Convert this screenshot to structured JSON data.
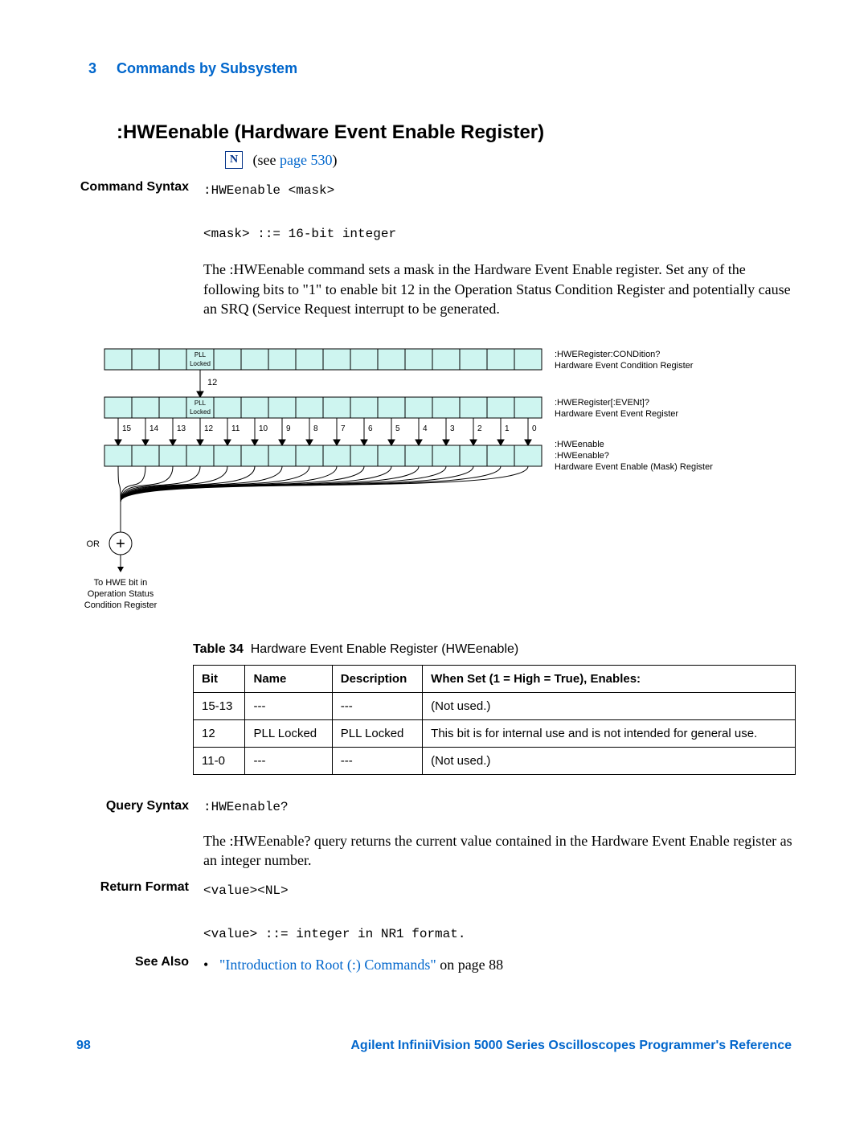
{
  "header": {
    "chapter_num": "3",
    "chapter_title": "Commands by Subsystem"
  },
  "title": ":HWEenable (Hardware Event Enable Register)",
  "see_prefix": "(see ",
  "see_link": "page 530",
  "see_suffix": ")",
  "command_syntax": {
    "label": "Command Syntax",
    "line1": ":HWEenable <mask>",
    "line2": "<mask> ::= 16-bit integer"
  },
  "desc_para": "The :HWEenable command sets a mask in the Hardware Event Enable register. Set any of the following bits to \"1\" to enable bit 12 in the Operation Status Condition Register and potentially cause an SRQ (Service Request interrupt to be generated.",
  "diagram": {
    "pll_label_top": "PLL",
    "pll_label_bottom": "Locked",
    "bit12_num": "12",
    "bit_numbers": [
      "15",
      "14",
      "13",
      "12",
      "11",
      "10",
      "9",
      "8",
      "7",
      "6",
      "5",
      "4",
      "3",
      "2",
      "1",
      "0"
    ],
    "row1_cmd": ":HWERegister:CONDition?",
    "row1_desc": "Hardware Event Condition Register",
    "row2_cmd": ":HWERegister[:EVENt]?",
    "row2_desc": "Hardware Event Event Register",
    "row3_cmd1": ":HWEenable",
    "row3_cmd2": ":HWEenable?",
    "row3_desc": "Hardware Event Enable (Mask) Register",
    "or_label": "OR",
    "plus": "+",
    "footnote1": "To HWE bit in",
    "footnote2": "Operation Status",
    "footnote3": "Condition Register"
  },
  "table": {
    "caption_lead": "Table 34",
    "caption_rest": "Hardware Event Enable Register (HWEenable)",
    "headers": [
      "Bit",
      "Name",
      "Description",
      "When Set (1 = High = True), Enables:"
    ],
    "rows": [
      {
        "bit": "15-13",
        "name": "---",
        "desc": "---",
        "when": "(Not used.)"
      },
      {
        "bit": "12",
        "name": "PLL Locked",
        "desc": "PLL Locked",
        "when": "This bit is for internal use and is not intended for general use."
      },
      {
        "bit": "11-0",
        "name": "---",
        "desc": "---",
        "when": "(Not used.)"
      }
    ]
  },
  "query_syntax": {
    "label": "Query Syntax",
    "cmd": ":HWEenable?",
    "para": "The :HWEenable? query returns the current value contained in the Hardware Event Enable register as an integer number."
  },
  "return_format": {
    "label": "Return Format",
    "line1": "<value><NL>",
    "line2": "<value> ::= integer in NR1 format."
  },
  "see_also": {
    "label": "See Also",
    "link_text": "\"Introduction to Root (:) Commands\"",
    "suffix": " on page 88"
  },
  "footer": {
    "page_num": "98",
    "doc_title": "Agilent InfiniiVision 5000 Series Oscilloscopes Programmer's Reference"
  }
}
